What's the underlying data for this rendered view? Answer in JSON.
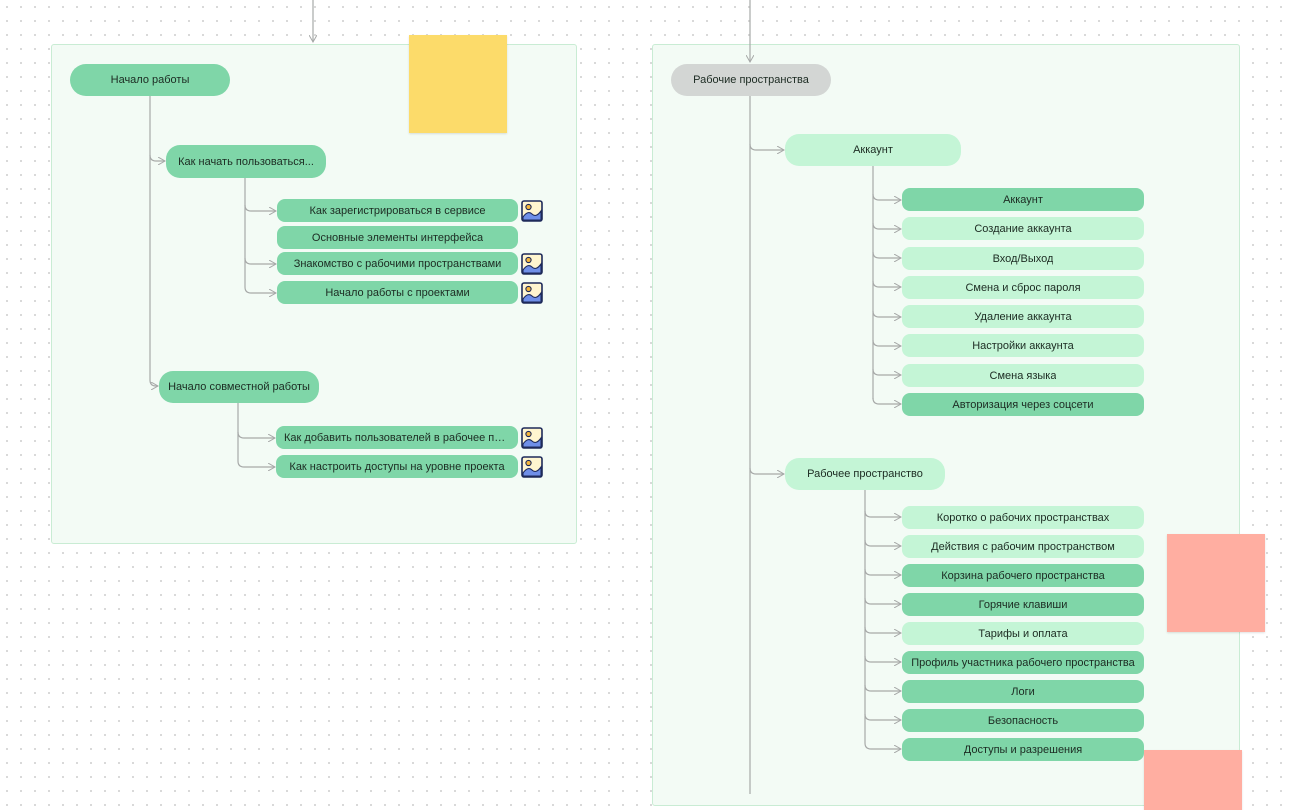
{
  "left": {
    "root": "Начало работы",
    "groups": [
      {
        "label": "Как начать пользоваться...",
        "items": [
          "Как зарегистрироваться в сервисе",
          "Основные элементы интерфейса",
          "Знакомство с рабочими пространствами",
          "Начало работы с проектами"
        ]
      },
      {
        "label": "Начало совместной работы",
        "items": [
          "Как добавить пользователей в рабочее про...",
          "Как настроить доступы на уровне проекта"
        ]
      }
    ]
  },
  "right": {
    "root": "Рабочие пространства",
    "groups": [
      {
        "label": "Аккаунт",
        "items": [
          "Аккаунт",
          "Создание аккаунта",
          "Вход/Выход",
          "Смена и сброс пароля",
          "Удаление аккаунта",
          "Настройки аккаунта",
          "Смена языка",
          "Авторизация через соцсети"
        ]
      },
      {
        "label": "Рабочее пространство",
        "items": [
          "Коротко о рабочих пространствах",
          "Действия с рабочим пространством",
          "Корзина рабочего пространства",
          "Горячие клавиши",
          "Тарифы и оплата",
          "Профиль участника рабочего пространства",
          "Логи",
          "Безопасность",
          "Доступы и разрешения"
        ]
      }
    ]
  },
  "colors": {
    "frame_bg": "#f3fbf5",
    "node_dark": "#7fd6a8",
    "node_light": "#c4f5d6",
    "node_grey": "#d3d6d4",
    "sticky_yellow": "#fcdb6a",
    "sticky_salmon": "#ffaea1",
    "connector": "#a7a9a8"
  },
  "icons": {
    "image_attachment": "image-icon"
  }
}
